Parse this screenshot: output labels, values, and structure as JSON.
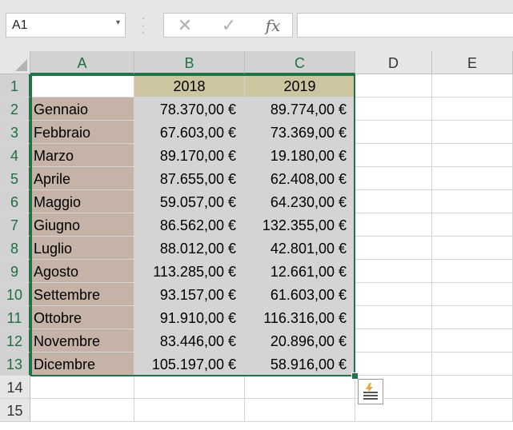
{
  "formula_bar": {
    "name_box_value": "A1",
    "cancel_icon": "✕",
    "enter_icon": "✓",
    "function_label": "fx",
    "formula_value": ""
  },
  "columns": [
    "A",
    "B",
    "C",
    "D",
    "E"
  ],
  "row_numbers": [
    "1",
    "2",
    "3",
    "4",
    "5",
    "6",
    "7",
    "8",
    "9",
    "10",
    "11",
    "12",
    "13",
    "14",
    "15"
  ],
  "header_row": {
    "a1": "",
    "b1": "2018",
    "c1": "2019"
  },
  "rows": [
    {
      "month": "Gennaio",
      "y2018": "78.370,00 €",
      "y2019": "89.774,00 €"
    },
    {
      "month": "Febbraio",
      "y2018": "67.603,00 €",
      "y2019": "73.369,00 €"
    },
    {
      "month": "Marzo",
      "y2018": "89.170,00 €",
      "y2019": "19.180,00 €"
    },
    {
      "month": "Aprile",
      "y2018": "87.655,00 €",
      "y2019": "62.408,00 €"
    },
    {
      "month": "Maggio",
      "y2018": "59.057,00 €",
      "y2019": "64.230,00 €"
    },
    {
      "month": "Giugno",
      "y2018": "86.562,00 €",
      "y2019": "132.355,00 €"
    },
    {
      "month": "Luglio",
      "y2018": "88.012,00 €",
      "y2019": "42.801,00 €"
    },
    {
      "month": "Agosto",
      "y2018": "113.285,00 €",
      "y2019": "12.661,00 €"
    },
    {
      "month": "Settembre",
      "y2018": "93.157,00 €",
      "y2019": "61.603,00 €"
    },
    {
      "month": "Ottobre",
      "y2018": "91.910,00 €",
      "y2019": "116.316,00 €"
    },
    {
      "month": "Novembre",
      "y2018": "83.446,00 €",
      "y2019": "20.896,00 €"
    },
    {
      "month": "Dicembre",
      "y2018": "105.197,00 €",
      "y2019": "58.916,00 €"
    }
  ],
  "colors": {
    "month_fill": "#c4b3a6",
    "year_header_fill": "#cdc4a0",
    "value_fill": "#d4d4d4",
    "selection_border": "#217346"
  },
  "quick_analysis": {
    "icon": "quick-analysis-icon"
  }
}
